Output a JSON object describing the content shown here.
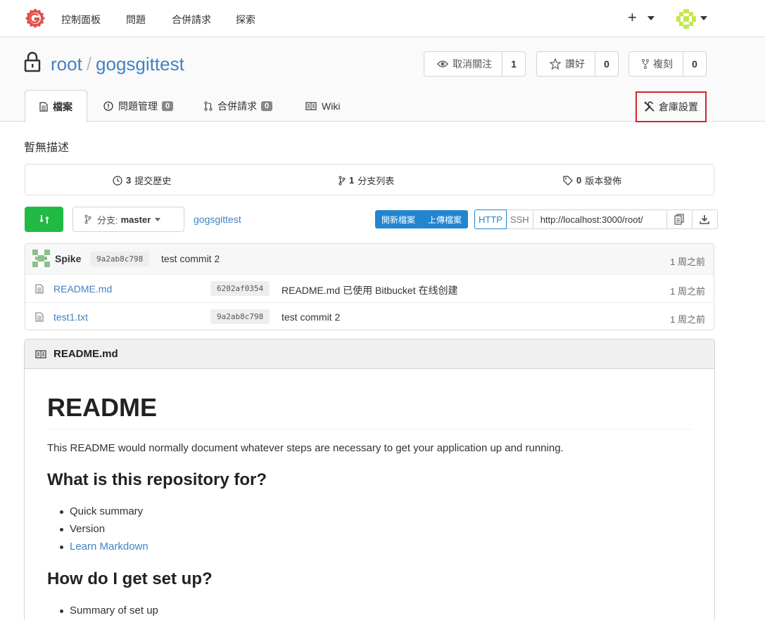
{
  "topnav": {
    "links": [
      "控制面板",
      "問題",
      "合併請求",
      "探索"
    ],
    "plus": "+"
  },
  "repo": {
    "owner": "root",
    "separator": "/",
    "name": "gogsgittest",
    "watch": {
      "label": "取消關注",
      "count": "1"
    },
    "star": {
      "label": "讚好",
      "count": "0"
    },
    "fork": {
      "label": "複刻",
      "count": "0"
    }
  },
  "tabs": {
    "files": "檔案",
    "issues": {
      "label": "問題管理",
      "count": "0"
    },
    "pulls": {
      "label": "合併請求",
      "count": "0"
    },
    "wiki": "Wiki",
    "settings": "倉庫設置"
  },
  "description": "暫無描述",
  "stats": {
    "commits": {
      "count": "3",
      "label": "提交歷史"
    },
    "branches": {
      "count": "1",
      "label": "分支列表"
    },
    "releases": {
      "count": "0",
      "label": "版本發佈"
    }
  },
  "actions": {
    "branch_prefix": "分支:",
    "branch": "master",
    "path": "gogsgittest",
    "new_file": "開新檔案",
    "upload_file": "上傳檔案",
    "http": "HTTP",
    "ssh": "SSH",
    "clone_url": "http://localhost:3000/root/"
  },
  "latest_commit": {
    "author": "Spike",
    "sha": "9a2ab8c798",
    "message": "test commit 2",
    "time": "1 周之前"
  },
  "files": [
    {
      "name": "README.md",
      "sha": "6202af0354",
      "message": "README.md 已使用 Bitbucket 在线创建",
      "time": "1 周之前"
    },
    {
      "name": "test1.txt",
      "sha": "9a2ab8c798",
      "message": "test commit 2",
      "time": "1 周之前"
    }
  ],
  "readme": {
    "filename": "README.md",
    "h1": "README",
    "intro": "This README would normally document whatever steps are necessary to get your application up and running.",
    "h2_1": "What is this repository for?",
    "list1": [
      "Quick summary",
      "Version",
      "Learn Markdown"
    ],
    "h2_2": "How do I get set up?",
    "list2": [
      "Summary of set up"
    ]
  },
  "colors": {
    "accent": "#4183c4",
    "green": "#21ba45",
    "blue": "#2185d0",
    "highlight": "#d0272d"
  }
}
